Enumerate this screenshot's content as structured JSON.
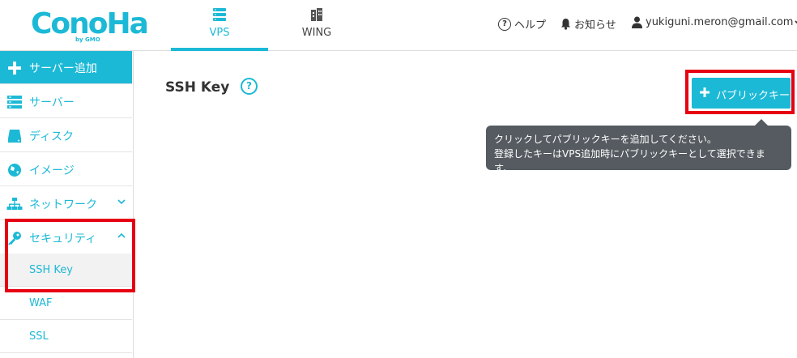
{
  "brand": {
    "logo_text": "ConoHa",
    "logo_sub": "by GMO"
  },
  "tabs": [
    {
      "label": "VPS",
      "icon": "server-stack-icon"
    },
    {
      "label": "WING",
      "icon": "building-icon"
    }
  ],
  "header": {
    "help_label": "ヘルプ",
    "notice_label": "お知らせ",
    "user_email": "yukiguni.meron@gmail.com"
  },
  "sidebar": {
    "add_server": "サーバー追加",
    "items": [
      {
        "label": "サーバー",
        "icon": "server-icon"
      },
      {
        "label": "ディスク",
        "icon": "disk-icon"
      },
      {
        "label": "イメージ",
        "icon": "globe-icon"
      },
      {
        "label": "ネットワーク",
        "icon": "network-icon"
      },
      {
        "label": "セキュリティ",
        "icon": "key-icon"
      }
    ],
    "sub_items": [
      {
        "label": "SSH Key"
      },
      {
        "label": "WAF"
      },
      {
        "label": "SSL"
      }
    ]
  },
  "main": {
    "title": "SSH Key",
    "add_button": "パブリックキー",
    "tooltip_line1": "クリックしてパブリックキーを追加してください。",
    "tooltip_line2": "登録したキーはVPS追加時にパブリックキーとして選択できます。"
  },
  "colors": {
    "accent": "#1cb9d6",
    "highlight": "#e60012",
    "tooltip_bg": "#555b60"
  }
}
